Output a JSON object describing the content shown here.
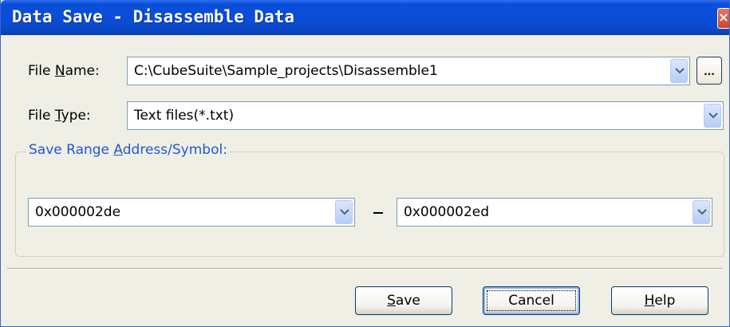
{
  "window": {
    "title": "Data Save - Disassemble Data"
  },
  "file_name": {
    "label_pre": "File ",
    "label_key": "N",
    "label_post": "ame:",
    "value": "C:\\CubeSuite\\Sample_projects\\Disassemble1",
    "browse_label": "..."
  },
  "file_type": {
    "label_pre": "File ",
    "label_key": "T",
    "label_post": "ype:",
    "value": "Text files(*.txt)"
  },
  "save_range": {
    "legend_pre": "Save Range ",
    "legend_key": "A",
    "legend_post": "ddress/Symbol:",
    "start_value": "0x000002de",
    "separator": "-",
    "end_value": "0x000002ed"
  },
  "buttons": {
    "save_key": "S",
    "save_rest": "ave",
    "cancel": "Cancel",
    "help_key": "H",
    "help_rest": "elp"
  },
  "colors": {
    "titlebar": "#0a4ed8",
    "dialog_bg": "#f0efe6",
    "group_legend": "#1f58d8"
  }
}
